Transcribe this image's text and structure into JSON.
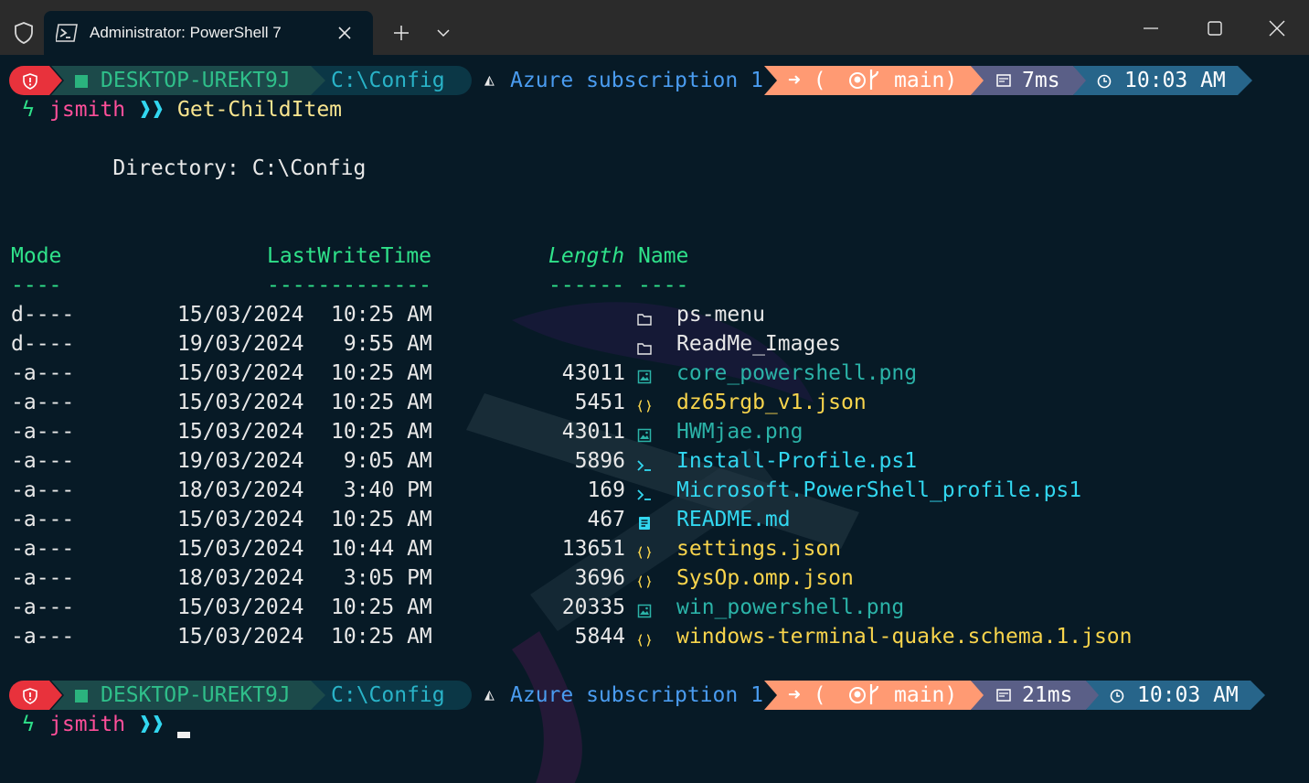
{
  "window": {
    "tab_title": "Administrator: PowerShell 7",
    "tab_icon": "powershell-icon",
    "shield_icon": "shield-icon",
    "new_tab_icon": "plus-icon",
    "dropdown_icon": "chevron-down-icon",
    "minimize_icon": "minimize-icon",
    "maximize_icon": "maximize-icon",
    "close_icon": "close-icon"
  },
  "colors": {
    "background": "#071a26",
    "titlebar": "#2b2b2b",
    "seg_admin": "#e8323c",
    "seg_host": "#1c4a4a",
    "seg_path": "#0b3746",
    "seg_git": "#ff9a73",
    "seg_time_exec": "#5a5f87",
    "seg_clock": "#27658a"
  },
  "prompt1": {
    "host": "DESKTOP-UREKT9J",
    "path": "C:\\Config",
    "azure": "Azure subscription 1",
    "git": "➜ (⦿ ᛘ main)",
    "git_prefix": "➜ (",
    "git_branch": "main)",
    "exec_time": "7ms",
    "clock": "10:03 AM",
    "user": "jsmith",
    "arrows": "❱❱",
    "command": "Get-ChildItem"
  },
  "listing": {
    "directory_label": "    Directory: C:\\Config",
    "headers": {
      "mode": "Mode",
      "lastwritetime": "LastWriteTime",
      "length": "Length",
      "name": "Name"
    },
    "underlines": {
      "mode": "----",
      "lastwritetime": "-------------",
      "length": "------",
      "name": "----"
    },
    "rows": [
      {
        "mode": "d----",
        "date": "15/03/2024",
        "time": "10:25 AM",
        "length": "",
        "icon": "folder-icon",
        "name": "ps-menu",
        "kind": "dir"
      },
      {
        "mode": "d----",
        "date": "19/03/2024",
        "time": " 9:55 AM",
        "length": "",
        "icon": "folder-icon",
        "name": "ReadMe_Images",
        "kind": "dir"
      },
      {
        "mode": "-a---",
        "date": "15/03/2024",
        "time": "10:25 AM",
        "length": "43011",
        "icon": "image-file-icon",
        "name": "core_powershell.png",
        "kind": "png"
      },
      {
        "mode": "-a---",
        "date": "15/03/2024",
        "time": "10:25 AM",
        "length": "5451",
        "icon": "json-file-icon",
        "name": "dz65rgb_v1.json",
        "kind": "json"
      },
      {
        "mode": "-a---",
        "date": "15/03/2024",
        "time": "10:25 AM",
        "length": "43011",
        "icon": "image-file-icon",
        "name": "HWMjae.png",
        "kind": "png"
      },
      {
        "mode": "-a---",
        "date": "19/03/2024",
        "time": " 9:05 AM",
        "length": "5896",
        "icon": "powershell-file-icon",
        "name": "Install-Profile.ps1",
        "kind": "ps1"
      },
      {
        "mode": "-a---",
        "date": "18/03/2024",
        "time": " 3:40 PM",
        "length": "169",
        "icon": "powershell-file-icon",
        "name": "Microsoft.PowerShell_profile.ps1",
        "kind": "ps1"
      },
      {
        "mode": "-a---",
        "date": "15/03/2024",
        "time": "10:25 AM",
        "length": "467",
        "icon": "markdown-file-icon",
        "name": "README.md",
        "kind": "md"
      },
      {
        "mode": "-a---",
        "date": "15/03/2024",
        "time": "10:44 AM",
        "length": "13651",
        "icon": "json-file-icon",
        "name": "settings.json",
        "kind": "json"
      },
      {
        "mode": "-a---",
        "date": "18/03/2024",
        "time": " 3:05 PM",
        "length": "3696",
        "icon": "json-file-icon",
        "name": "SysOp.omp.json",
        "kind": "json"
      },
      {
        "mode": "-a---",
        "date": "15/03/2024",
        "time": "10:25 AM",
        "length": "20335",
        "icon": "image-file-icon",
        "name": "win_powershell.png",
        "kind": "png"
      },
      {
        "mode": "-a---",
        "date": "15/03/2024",
        "time": "10:25 AM",
        "length": "5844",
        "icon": "json-file-icon",
        "name": "windows-terminal-quake.schema.1.json",
        "kind": "json"
      }
    ]
  },
  "prompt2": {
    "host": "DESKTOP-UREKT9J",
    "path": "C:\\Config",
    "azure": "Azure subscription 1",
    "git_prefix": "➜ (",
    "git_branch": "main)",
    "exec_time": "21ms",
    "clock": "10:03 AM",
    "user": "jsmith",
    "arrows": "❱❱"
  }
}
